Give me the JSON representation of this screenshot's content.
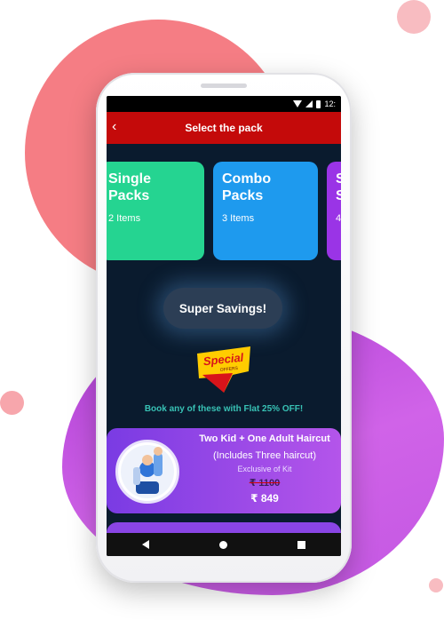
{
  "status_bar": {
    "time": "12:"
  },
  "app_bar": {
    "title": "Select the pack"
  },
  "packs_carousel": [
    {
      "title": "Single\nPacks",
      "subtitle": "2 Items",
      "color": "#25d491"
    },
    {
      "title": "Combo\nPacks",
      "subtitle": "3 Items",
      "color": "#1e9aee"
    },
    {
      "title": "S\nS",
      "subtitle": "4",
      "color": "#9a34e6"
    }
  ],
  "savings_button": {
    "label": "Super Savings!"
  },
  "special_offers_badge": {
    "line1": "Special",
    "line2": "OFFERS"
  },
  "offer_text": "Book any of these with Flat 25% OFF!",
  "pack_card": {
    "title": "Two Kid + One Adult Haircut",
    "includes": "(Includes Three haircut)",
    "kit": "Exclusive of Kit",
    "old_price": "₹ 1100",
    "new_price": "₹ 849"
  },
  "colors": {
    "app_bar": "#c40a0a",
    "screen_bg": "#0a1b2e",
    "offer_text": "#38c2b5"
  },
  "icons": [
    "back-arrow-icon",
    "wifi-icon",
    "signal-icon",
    "battery-icon",
    "nav-back-icon",
    "nav-home-icon",
    "nav-recent-icon"
  ]
}
